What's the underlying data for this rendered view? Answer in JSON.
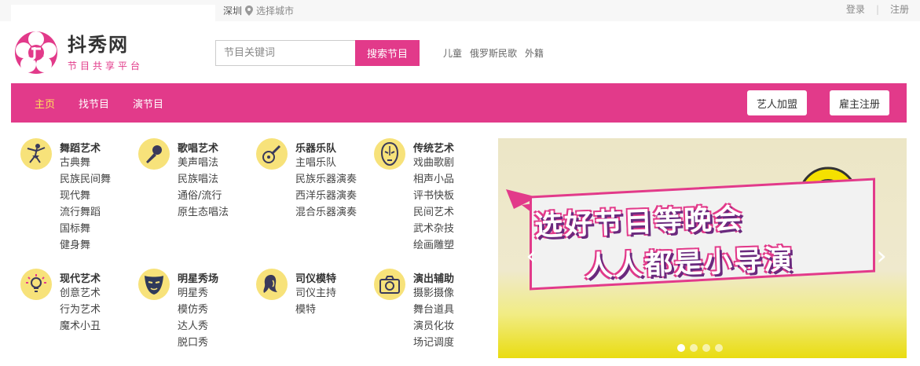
{
  "topbar": {
    "city": "深圳",
    "city_pick": "选择城市",
    "login": "登录",
    "register": "注册"
  },
  "logo": {
    "name": "抖秀网",
    "slogan": "节目共享平台"
  },
  "search": {
    "placeholder": "节目关键词",
    "button": "搜索节目"
  },
  "hot_tags": [
    "儿童",
    "俄罗斯民歌",
    "外籍"
  ],
  "nav": {
    "items": [
      "主页",
      "找节目",
      "演节目"
    ],
    "artist_join": "艺人加盟",
    "employer_register": "雇主注册"
  },
  "categories": [
    {
      "title": "舞蹈艺术",
      "icon": "dancer-icon",
      "items": [
        "古典舞",
        "民族民间舞",
        "现代舞",
        "流行舞蹈",
        "国标舞",
        "健身舞"
      ]
    },
    {
      "title": "歌唱艺术",
      "icon": "microphone-icon",
      "items": [
        "美声唱法",
        "民族唱法",
        "通俗/流行",
        "原生态唱法"
      ]
    },
    {
      "title": "乐器乐队",
      "icon": "guitar-icon",
      "items": [
        "主唱乐队",
        "民族乐器演奏",
        "西洋乐器演奏",
        "混合乐器演奏"
      ]
    },
    {
      "title": "传统艺术",
      "icon": "opera-mask-icon",
      "items": [
        "戏曲歌剧",
        "相声小品",
        "评书快板",
        "民间艺术",
        "武术杂技",
        "绘画雕塑"
      ]
    },
    {
      "title": "现代艺术",
      "icon": "lightbulb-icon",
      "items": [
        "创意艺术",
        "行为艺术",
        "魔术小丑"
      ]
    },
    {
      "title": "明星秀场",
      "icon": "star-mask-icon",
      "items": [
        "明星秀",
        "模仿秀",
        "达人秀",
        "脱口秀"
      ]
    },
    {
      "title": "司仪模特",
      "icon": "model-icon",
      "items": [
        "司仪主持",
        "模特"
      ]
    },
    {
      "title": "演出辅助",
      "icon": "camera-icon",
      "items": [
        "摄影摄像",
        "舞台道具",
        "演员化妆",
        "场记调度"
      ]
    }
  ],
  "banner": {
    "line1": "选好节目等晚会",
    "line2": "人人都是小导演"
  },
  "colors": {
    "brand": "#e23a8a",
    "nav_active": "#ffe35c",
    "icon_bg": "#f7e27a"
  }
}
